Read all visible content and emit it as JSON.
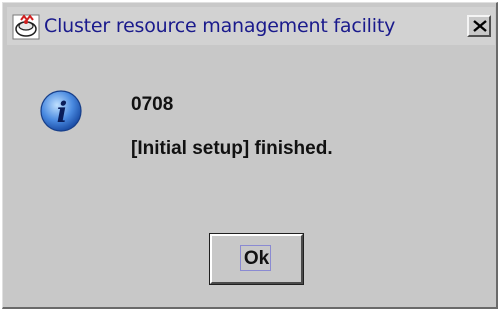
{
  "window": {
    "title": "Cluster resource management facility",
    "icon": "cluster-app-icon",
    "close_label": "close"
  },
  "message": {
    "icon": "info-icon",
    "code": "0708",
    "text": "[Initial setup]  finished."
  },
  "buttons": {
    "ok_label": "Ok"
  },
  "colors": {
    "dialog_bg": "#c8c8c8",
    "title_text": "#1a1a8c",
    "info_icon": "#3a78d8"
  }
}
